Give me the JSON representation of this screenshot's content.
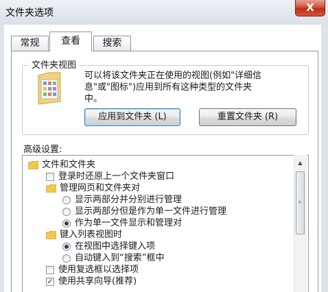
{
  "window": {
    "title": "文件夹选项",
    "close_label": "X"
  },
  "tabs": [
    {
      "label": "常规",
      "active": false
    },
    {
      "label": "查看",
      "active": true
    },
    {
      "label": "搜索",
      "active": false
    }
  ],
  "folder_views": {
    "legend": "文件夹视图",
    "description": "可以将该文件夹正在使用的视图(例如\"详细信\n息\"或\"图标\")应用到所有这种类型的文件夹\n中。",
    "apply_button": "应用到文件夹 (L)",
    "reset_button": "重置文件夹 (R)"
  },
  "advanced": {
    "label": "高级设置:",
    "items": [
      {
        "type": "folder",
        "label": "文件和文件夹",
        "level": 0
      },
      {
        "type": "checkbox",
        "label": "登录时还原上一个文件夹窗口",
        "checked": false,
        "level": 1
      },
      {
        "type": "folder",
        "label": "管理网页和文件夹对",
        "level": 1
      },
      {
        "type": "radio",
        "label": "显示两部分并分别进行管理",
        "checked": false,
        "level": 2
      },
      {
        "type": "radio",
        "label": "显示两部分但是作为单一文件进行管理",
        "checked": false,
        "level": 2
      },
      {
        "type": "radio",
        "label": "作为单一文件显示和管理对",
        "checked": true,
        "level": 2
      },
      {
        "type": "folder",
        "label": "键入列表视图时",
        "level": 1
      },
      {
        "type": "radio",
        "label": "在视图中选择键入项",
        "checked": true,
        "level": 2
      },
      {
        "type": "radio",
        "label": "自动键入到“搜索”框中",
        "checked": false,
        "level": 2
      },
      {
        "type": "checkbox",
        "label": "使用复选框以选择项",
        "checked": false,
        "level": 1
      },
      {
        "type": "checkbox",
        "label": "使用共享向导(推荐)",
        "checked": true,
        "level": 1
      }
    ]
  },
  "colors": {
    "accent": "#3c7fb1",
    "close": "#c8391f"
  }
}
